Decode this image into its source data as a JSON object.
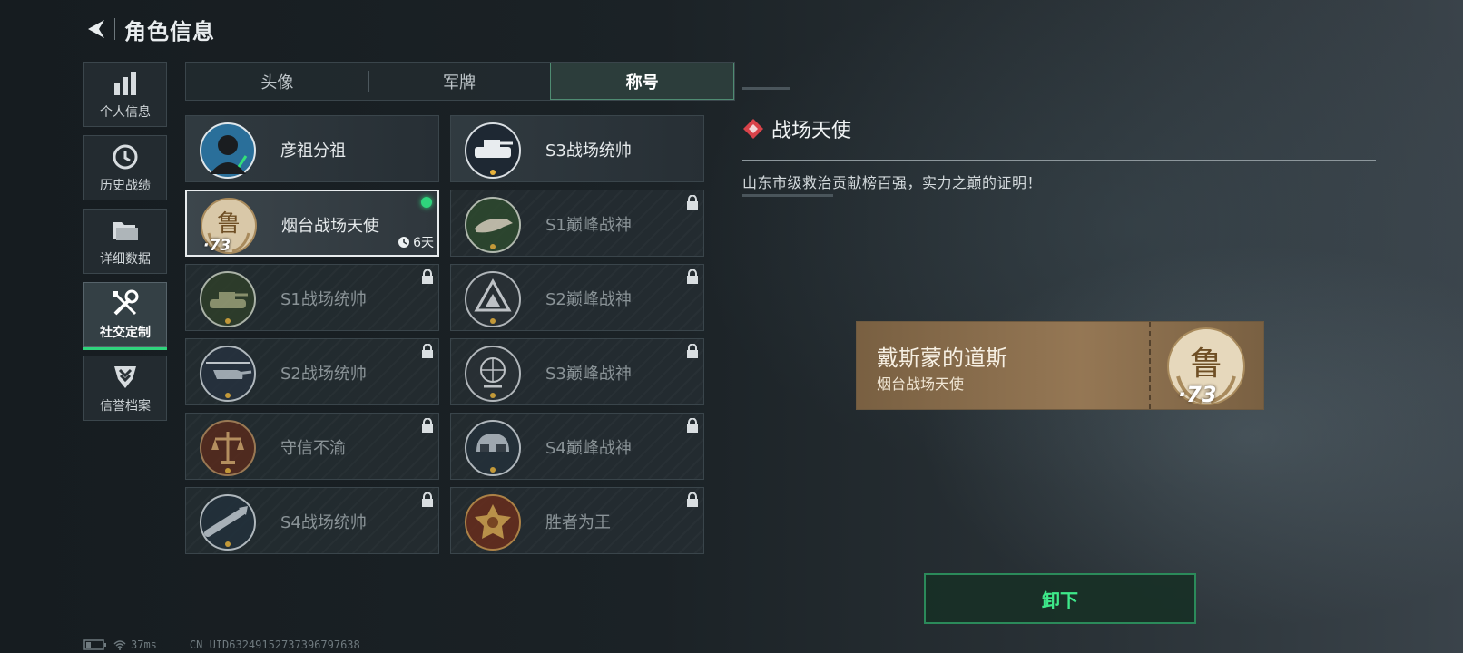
{
  "header": {
    "title": "角色信息"
  },
  "nav": [
    {
      "label": "个人信息",
      "icon": "bar-chart-icon"
    },
    {
      "label": "历史战绩",
      "icon": "history-clock-icon"
    },
    {
      "label": "详细数据",
      "icon": "folder-icon"
    },
    {
      "label": "社交定制",
      "icon": "wrench-screwdriver-icon",
      "active": true
    },
    {
      "label": "信誉档案",
      "icon": "shield-chevron-icon"
    }
  ],
  "tabs": [
    {
      "label": "头像"
    },
    {
      "label": "军牌"
    },
    {
      "label": "称号",
      "active": true
    }
  ],
  "titles": [
    {
      "name": "彦祖分祖",
      "badge": "portrait-badge-icon",
      "locked": false
    },
    {
      "name": "S3战场统帅",
      "badge": "armored-vehicle-badge-icon",
      "locked": false
    },
    {
      "name": "烟台战场天使",
      "badge": "lu-emblem-badge-icon",
      "badge_number": "73",
      "selected": true,
      "equipped": true,
      "remaining": "6天"
    },
    {
      "name": "S1巅峰战神",
      "badge": "crocodile-badge-icon",
      "locked": true
    },
    {
      "name": "S1战场统帅",
      "badge": "tank-badge-icon",
      "locked": true
    },
    {
      "name": "S2巅峰战神",
      "badge": "triangle-emblem-badge-icon",
      "locked": true
    },
    {
      "name": "S2战场统帅",
      "badge": "helicopter-badge-icon",
      "locked": true
    },
    {
      "name": "S3巅峰战神",
      "badge": "globe-badge-icon",
      "locked": true
    },
    {
      "name": "守信不渝",
      "badge": "scales-badge-icon",
      "locked": true
    },
    {
      "name": "S4巅峰战神",
      "badge": "helmet-badge-icon",
      "locked": true
    },
    {
      "name": "S4战场统帅",
      "badge": "missile-badge-icon",
      "locked": true
    },
    {
      "name": "胜者为王",
      "badge": "medal-badge-icon",
      "locked": true
    }
  ],
  "detail": {
    "title": "战场天使",
    "description": "山东市级救治贡献榜百强，实力之巅的证明！"
  },
  "nameplate": {
    "player_name": "戴斯蒙的道斯",
    "title": "烟台战场天使",
    "number": "73"
  },
  "actions": {
    "unequip_label": "卸下"
  },
  "status": {
    "ping": "37ms",
    "uid": "CN UID6324915273739679763​8"
  },
  "colors": {
    "accent_green": "#2fd47c",
    "button_text": "#3ee88a",
    "nameplate_bg": "#8a6f4e"
  }
}
